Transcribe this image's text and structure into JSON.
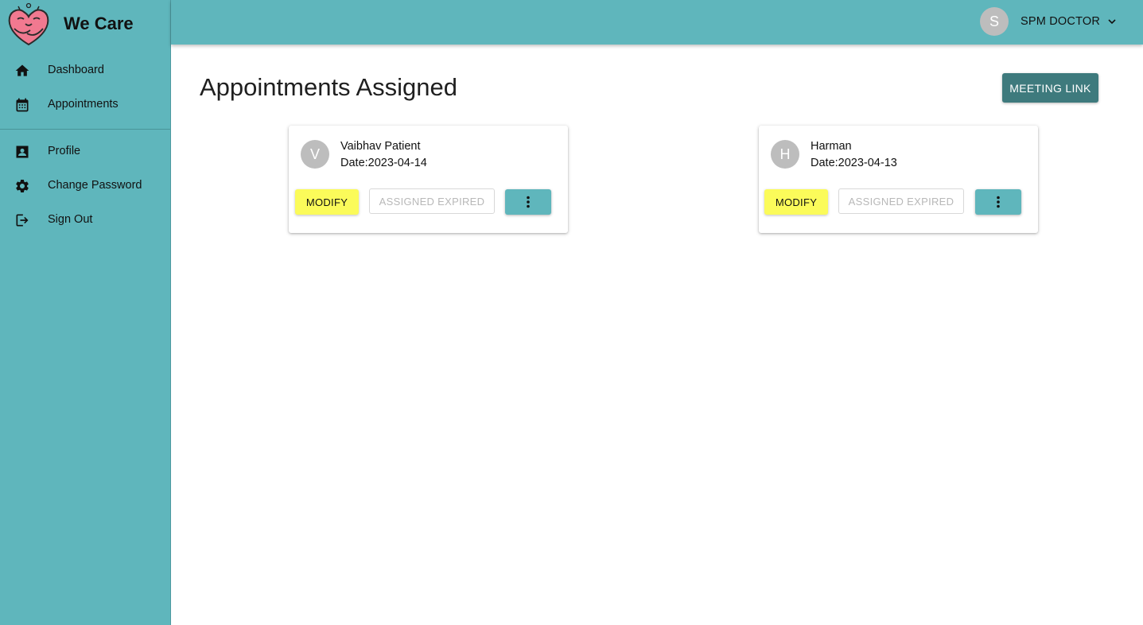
{
  "app": {
    "title": "We Care"
  },
  "sidebar": {
    "items": [
      {
        "label": "Dashboard",
        "icon": "home-icon"
      },
      {
        "label": "Appointments",
        "icon": "calendar-icon"
      },
      {
        "label": "Profile",
        "icon": "contact-card-icon"
      },
      {
        "label": "Change Password",
        "icon": "gear-icon"
      },
      {
        "label": "Sign Out",
        "icon": "logout-icon"
      }
    ]
  },
  "header": {
    "user": {
      "initial": "S",
      "name": "SPM DOCTOR"
    }
  },
  "main": {
    "title": "Appointments Assigned",
    "meeting_link_label": "MEETING LINK",
    "cards": [
      {
        "initial": "V",
        "name": "Vaibhav Patient",
        "date": "Date:2023-04-14",
        "modify_label": "MODIFY",
        "status_label": "ASSIGNED EXPIRED"
      },
      {
        "initial": "H",
        "name": "Harman",
        "date": "Date:2023-04-13",
        "modify_label": "MODIFY",
        "status_label": "ASSIGNED EXPIRED"
      }
    ]
  },
  "colors": {
    "teal": "#5fb6bc",
    "dark_teal": "#3e7a7d",
    "yellow": "#fbfb5a",
    "avatar_grey": "#bdbdbd"
  }
}
